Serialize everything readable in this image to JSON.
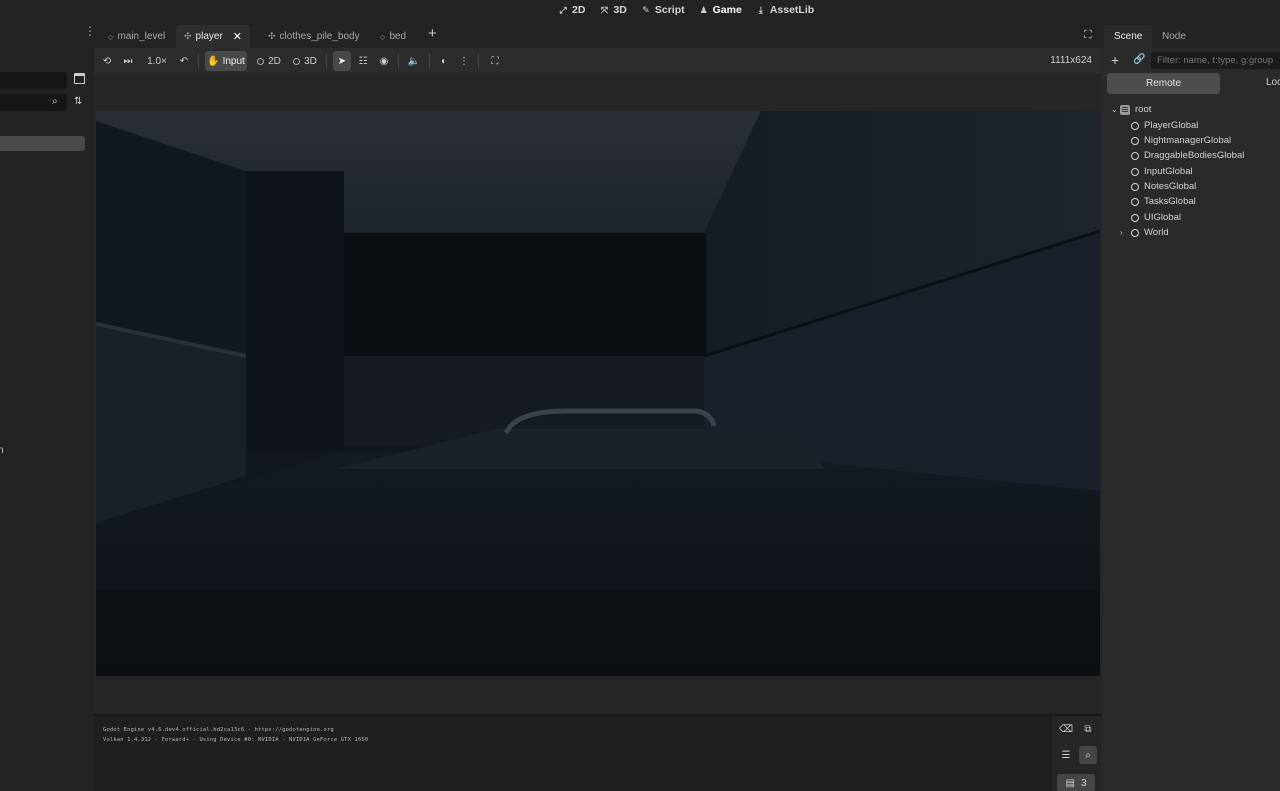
{
  "workspaces": [
    {
      "label": "2D",
      "icon": "2d-icon"
    },
    {
      "label": "3D",
      "icon": "3d-icon"
    },
    {
      "label": "Script",
      "icon": "script-icon"
    },
    {
      "label": "Game",
      "icon": "game-icon",
      "active": true
    },
    {
      "label": "AssetLib",
      "icon": "assetlib-icon"
    }
  ],
  "editor_tabs": [
    {
      "label": "main_level",
      "icon": "scene-node-icon"
    },
    {
      "label": "player",
      "icon": "character-icon",
      "active": true
    },
    {
      "label": "clothes_pile_body",
      "icon": "character-icon"
    },
    {
      "label": "bed",
      "icon": "scene-node-icon"
    }
  ],
  "toolbar": {
    "speed": "1.0×",
    "input_label": "Input",
    "mode_2d": "2D",
    "mode_3d": "3D",
    "resolution": "1111x624"
  },
  "output_log": [
    "Godot Engine v4.6.dev4.official.bd2ca13c6 - https://godotengine.org",
    "Vulkan 1.4.312 - Forward+ - Using Device #0: NVIDIA - NVIDIA GeForce GTX 1650"
  ],
  "log_counter": "3",
  "right_dock": {
    "tabs": [
      "Scene",
      "Node"
    ],
    "filter_placeholder": "Filter: name, t:type, g:group",
    "remote_label": "Remote",
    "local_label": "Loc",
    "tree": [
      {
        "label": "root",
        "depth": 0,
        "expanded": true,
        "icon": "root-window-icon"
      },
      {
        "label": "PlayerGlobal",
        "depth": 1,
        "icon": "node-icon"
      },
      {
        "label": "NightmanagerGlobal",
        "depth": 1,
        "icon": "node-icon"
      },
      {
        "label": "DraggableBodiesGlobal",
        "depth": 1,
        "icon": "node-icon"
      },
      {
        "label": "InputGlobal",
        "depth": 1,
        "icon": "node-icon"
      },
      {
        "label": "NotesGlobal",
        "depth": 1,
        "icon": "node-icon"
      },
      {
        "label": "TasksGlobal",
        "depth": 1,
        "icon": "node-icon"
      },
      {
        "label": "UIGlobal",
        "depth": 1,
        "icon": "node-icon"
      },
      {
        "label": "World",
        "depth": 1,
        "collapsed": true,
        "icon": "node-icon"
      }
    ]
  },
  "left_dock": {
    "stray_text": "n"
  },
  "colors": {
    "editor_bg": "#1d1d1d",
    "panel_bg": "#232323",
    "viewport_bg": "#12171d",
    "pressed_button": "#494949"
  }
}
